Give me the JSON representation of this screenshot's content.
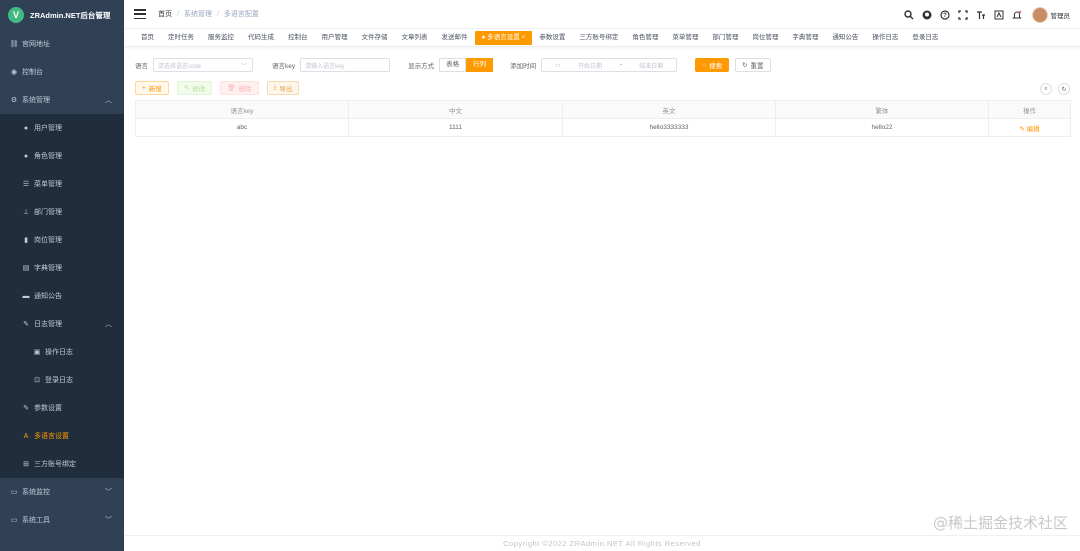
{
  "sidebar": {
    "logo_letter": "V",
    "title": "ZRAdmin.NET后台管理",
    "items": [
      {
        "label": "官网地址",
        "icon": "link-icon"
      },
      {
        "label": "控制台",
        "icon": "dashboard-icon"
      },
      {
        "label": "系统管理",
        "icon": "system-icon",
        "expanded": true
      },
      {
        "label": "用户管理",
        "icon": "user-icon"
      },
      {
        "label": "角色管理",
        "icon": "peoples-icon"
      },
      {
        "label": "菜单管理",
        "icon": "tree-table-icon"
      },
      {
        "label": "部门管理",
        "icon": "tree-icon"
      },
      {
        "label": "岗位管理",
        "icon": "post-icon"
      },
      {
        "label": "字典管理",
        "icon": "dict-icon"
      },
      {
        "label": "通知公告",
        "icon": "message-icon"
      },
      {
        "label": "日志管理",
        "icon": "log-icon",
        "expanded": true
      },
      {
        "label": "操作日志",
        "icon": "form-icon"
      },
      {
        "label": "登录日志",
        "icon": "logininfor-icon"
      },
      {
        "label": "参数设置",
        "icon": "edit-icon"
      },
      {
        "label": "多语言设置",
        "icon": "language-icon",
        "active": true
      },
      {
        "label": "三方账号绑定",
        "icon": "bind-icon"
      },
      {
        "label": "系统监控",
        "icon": "monitor-icon"
      },
      {
        "label": "系统工具",
        "icon": "tool-icon"
      }
    ]
  },
  "navbar": {
    "breadcrumb": [
      "首页",
      "系统管理",
      "多语言配置"
    ],
    "username": "管理员",
    "accent": "#ff9900"
  },
  "tags": [
    "首页",
    "定时任务",
    "服务监控",
    "代码生成",
    "控制台",
    "用户管理",
    "文件存储",
    "文章列表",
    "发送邮件",
    "多语言设置",
    "参数设置",
    "三方账号绑定",
    "角色管理",
    "菜单管理",
    "部门管理",
    "岗位管理",
    "字典管理",
    "通知公告",
    "操作日志",
    "登录日志"
  ],
  "search": {
    "lang_label": "语言",
    "lang_placeholder": "请选择语言code",
    "key_label": "语言key",
    "key_placeholder": "请输入语言key",
    "mode_label": "显示方式",
    "mode_table": "表格",
    "mode_row": "行列",
    "date_label": "添加时间",
    "date_start": "开始日期",
    "date_sep": "-",
    "date_end": "结束日期",
    "search_btn": "搜索",
    "reset_btn": "重置"
  },
  "toolbar": {
    "add": "新增",
    "edit": "修改",
    "delete": "删除",
    "export": "导出"
  },
  "table": {
    "headers": [
      "语言key",
      "中文",
      "英文",
      "繁体",
      "操作"
    ],
    "rows": [
      {
        "key": "abc",
        "zh": "1111",
        "en": "hello3333333",
        "tw": "hello22",
        "action": "编辑"
      }
    ]
  },
  "footer": "Copyright ©2022 ZRAdmin.NET All Rights Reserved",
  "watermark": "@稀土掘金技术社区"
}
